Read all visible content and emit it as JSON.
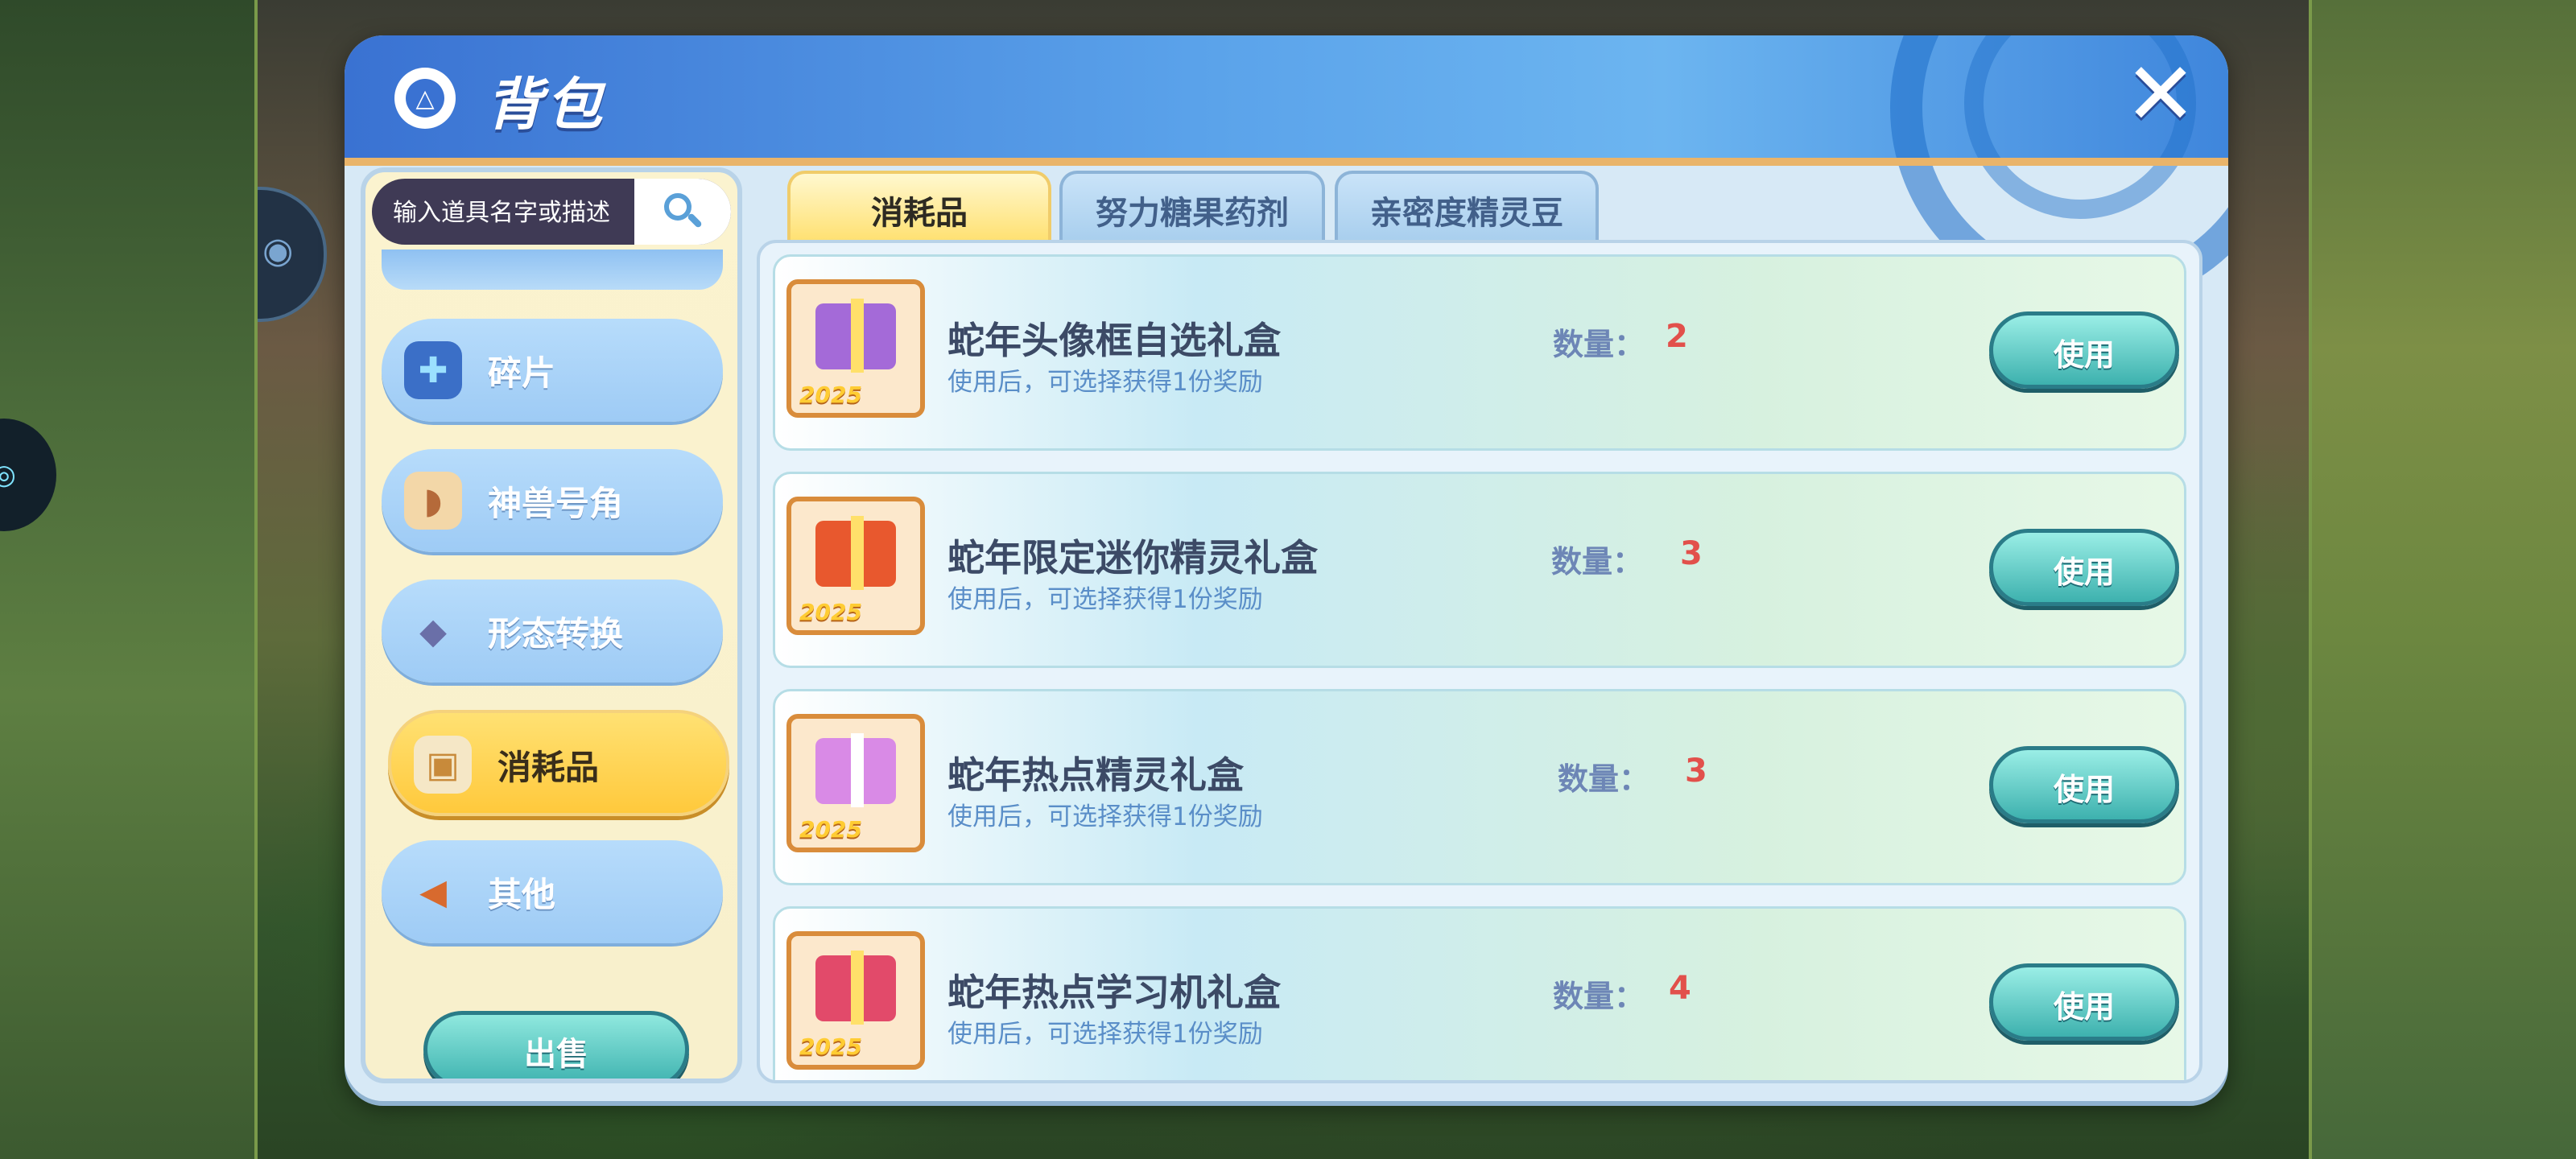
{
  "window": {
    "title": "背包",
    "close_icon": "✕"
  },
  "search": {
    "placeholder": "输入道具名字或描述",
    "icon": "magnifier-icon"
  },
  "sidebar": {
    "items": [
      {
        "label": "碎片",
        "icon": "puzzle-icon",
        "glyph": "🧩",
        "active": false
      },
      {
        "label": "神兽号角",
        "icon": "horn-icon",
        "glyph": "📯",
        "active": false
      },
      {
        "label": "形态转换",
        "icon": "crystal-icon",
        "glyph": "◆",
        "active": false
      },
      {
        "label": "消耗品",
        "icon": "gift-box-icon",
        "glyph": "🎁",
        "active": true
      },
      {
        "label": "其他",
        "icon": "megaphone-icon",
        "glyph": "📢",
        "active": false
      }
    ],
    "sell_label": "出售"
  },
  "tabs": [
    {
      "label": "消耗品",
      "active": true
    },
    {
      "label": "努力糖果药剂",
      "active": false
    },
    {
      "label": "亲密度精灵豆",
      "active": false
    }
  ],
  "items": [
    {
      "name": "蛇年头像框自选礼盒",
      "desc": "使用后，可选择获得1份奖励",
      "qty_label": "数量：",
      "qty": "2",
      "use_label": "使用",
      "thumb_year": "2025",
      "thumb_color": "#a46ad8",
      "icon": "avatar-frame-gift-icon"
    },
    {
      "name": "蛇年限定迷你精灵礼盒",
      "desc": "使用后，可选择获得1份奖励",
      "qty_label": "数量：",
      "qty": "3",
      "use_label": "使用",
      "thumb_year": "2025",
      "thumb_color": "#e8582e",
      "icon": "mini-spirit-gift-icon"
    },
    {
      "name": "蛇年热点精灵礼盒",
      "desc": "使用后，可选择获得1份奖励",
      "qty_label": "数量：",
      "qty": "3",
      "use_label": "使用",
      "thumb_year": "2025",
      "thumb_color": "#d98ae6",
      "icon": "spirit-gift-icon"
    },
    {
      "name": "蛇年热点学习机礼盒",
      "desc": "使用后，可选择获得1份奖励",
      "qty_label": "数量：",
      "qty": "4",
      "use_label": "使用",
      "thumb_year": "2025",
      "thumb_color": "#e24a6a",
      "icon": "learning-machine-gift-icon"
    }
  ],
  "colors": {
    "header": "#4b8fe0",
    "accent_yellow": "#ffc93c",
    "button_teal": "#3fb3b0",
    "qty_red": "#e2504b"
  }
}
